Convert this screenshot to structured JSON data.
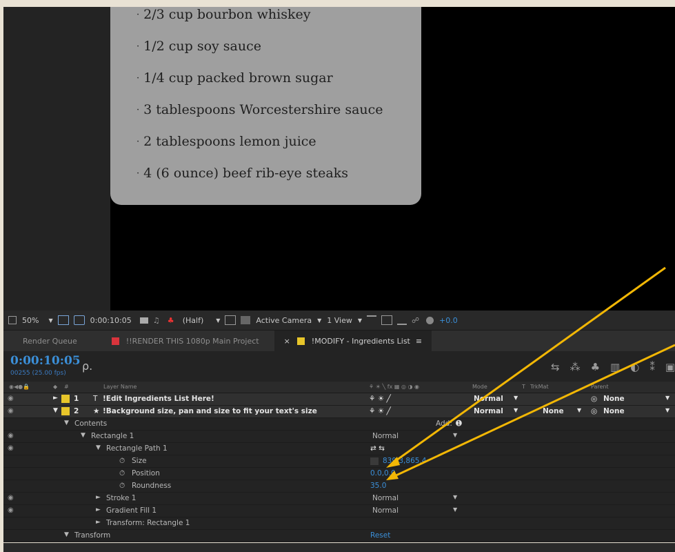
{
  "preview": {
    "ingredients": [
      "2/3 cup bourbon whiskey",
      "1/2 cup soy sauce",
      "1/4 cup packed brown sugar",
      "3 tablespoons Worcestershire sauce",
      "2 tablespoons lemon juice",
      "4 (6 ounce) beef rib-eye steaks"
    ],
    "bullet": "·"
  },
  "viewer_toolbar": {
    "zoom": "50%",
    "timecode": "0:00:10:05",
    "resolution": "(Half)",
    "camera": "Active Camera",
    "views": "1 View",
    "exposure": "+0.0"
  },
  "tabs": [
    {
      "label": "Render Queue"
    },
    {
      "label": "!!RENDER THIS 1080p Main Project",
      "color": "#d8343c"
    },
    {
      "label": "!MODIFY - Ingredients List",
      "color": "#e7c52a",
      "close": "×",
      "menu": "≡"
    }
  ],
  "timeline": {
    "timecode": "0:00:10:05",
    "fps": "00255 (25.00 fps)",
    "search_icon": "ρ.",
    "columns": {
      "hash": "#",
      "layer_name": "Layer Name",
      "mode": "Mode",
      "t": "T",
      "trkmat": "TrkMat",
      "parent": "Parent"
    },
    "add_label": "Add:"
  },
  "rows": {
    "layer1": {
      "num": "1",
      "name": "!Edit Ingredients List Here!",
      "mode": "Normal",
      "parent": "None"
    },
    "layer2": {
      "num": "2",
      "name": "!Background size, pan and size to fit your text's size",
      "mode": "Normal",
      "trkmat": "None",
      "parent": "None"
    },
    "contents": "Contents",
    "rect1": {
      "name": "Rectangle 1",
      "mode": "Normal"
    },
    "rectpath": "Rectangle Path 1",
    "size": {
      "label": "Size",
      "value": "839.3,865.4"
    },
    "position": {
      "label": "Position",
      "value": "0.0,0.0"
    },
    "roundness": {
      "label": "Roundness",
      "value": "35.0"
    },
    "stroke": {
      "name": "Stroke 1",
      "mode": "Normal"
    },
    "gradient": {
      "name": "Gradient Fill 1",
      "mode": "Normal"
    },
    "transform_rect": "Transform: Rectangle 1",
    "transform": {
      "name": "Transform",
      "value": "Reset"
    }
  },
  "colors": {
    "accent_blue": "#3b8fd8",
    "label_yellow": "#e7c52a",
    "arrow": "#f2b705"
  }
}
